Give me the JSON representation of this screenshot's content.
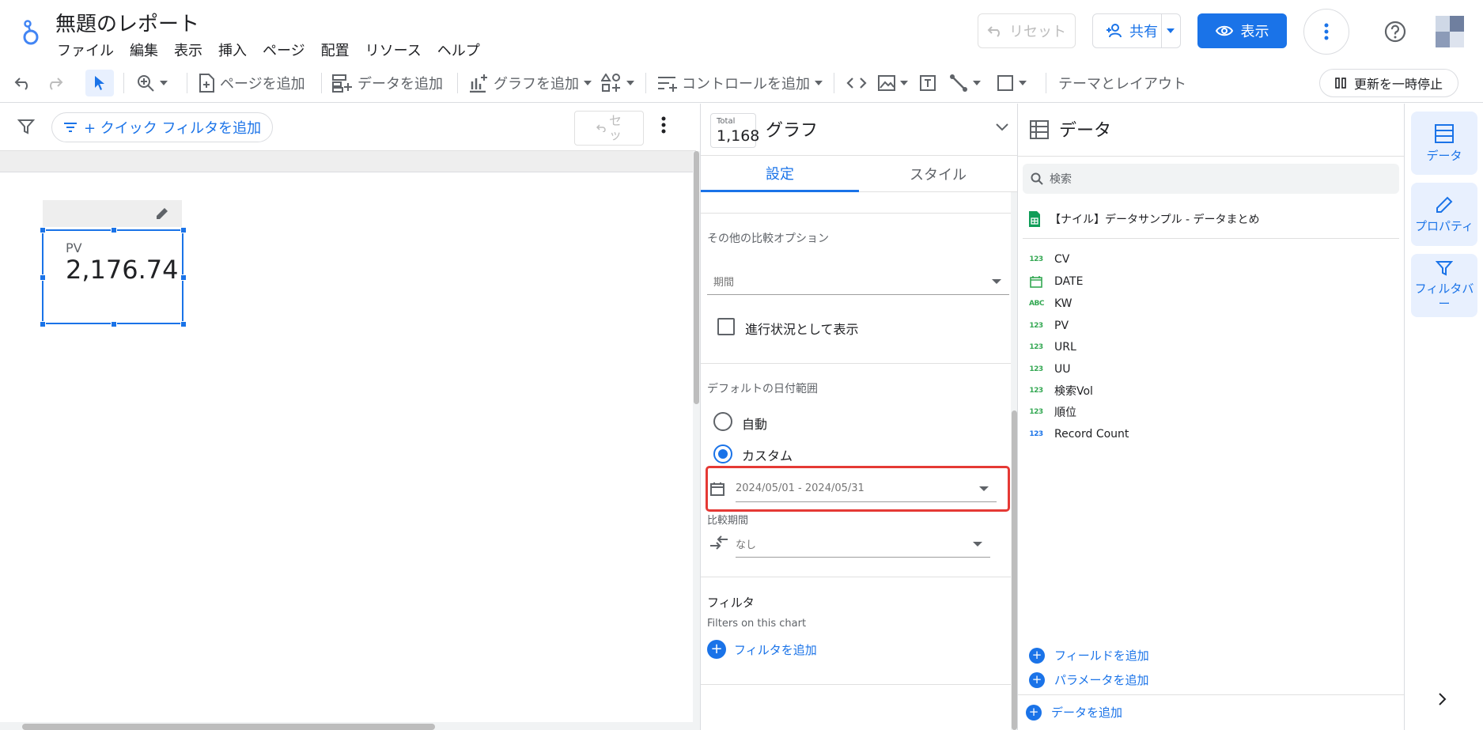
{
  "header": {
    "title": "無題のレポート",
    "menu": [
      "ファイル",
      "編集",
      "表示",
      "挿入",
      "ページ",
      "配置",
      "リソース",
      "ヘルプ"
    ],
    "reset_label": "リセット",
    "share_label": "共有",
    "view_label": "表示"
  },
  "toolbar": {
    "add_page": "ページを追加",
    "add_data": "データを追加",
    "add_chart": "グラフを追加",
    "add_control": "コントロールを追加",
    "theme_layout": "テーマとレイアウト",
    "pause_updates": "更新を一時停止"
  },
  "canvas": {
    "quick_filter": "+ クイック フィルタを追加",
    "reset_small_top": "セ",
    "reset_small_bottom": "ッ",
    "scorecard": {
      "label": "PV",
      "value": "2,176.74"
    }
  },
  "props": {
    "total_label": "Total",
    "total_value": "1,168",
    "title": "グラフ",
    "tabs": [
      "設定",
      "スタイル"
    ],
    "other_compare": "その他の比較オプション",
    "period_placeholder": "期間",
    "show_progress": "進行状況として表示",
    "default_date_range": "デフォルトの日付範囲",
    "auto": "自動",
    "custom": "カスタム",
    "date_range": "2024/05/01 - 2024/05/31",
    "compare_period": "比較期間",
    "compare_none": "なし",
    "filter_title": "フィルタ",
    "filter_sub": "Filters on this chart",
    "add_filter": "フィルタを追加"
  },
  "data": {
    "title": "データ",
    "search_placeholder": "検索",
    "source": "【ナイル】データサンプル - データまとめ",
    "fields": [
      {
        "type": "123",
        "name": "CV"
      },
      {
        "type": "date",
        "name": "DATE"
      },
      {
        "type": "ABC",
        "name": "KW"
      },
      {
        "type": "123",
        "name": "PV"
      },
      {
        "type": "123",
        "name": "URL"
      },
      {
        "type": "123",
        "name": "UU"
      },
      {
        "type": "123",
        "name": "検索Vol"
      },
      {
        "type": "123",
        "name": "順位"
      },
      {
        "type": "123",
        "name": "Record Count"
      }
    ],
    "add_field": "フィールドを追加",
    "add_parameter": "パラメータを追加",
    "add_data": "データを追加"
  },
  "rail": {
    "data": "データ",
    "properties": "プロパティ",
    "filter_bar_top": "フィルタバ",
    "filter_bar_bottom": "ー"
  },
  "colors": {
    "accent": "#1a73e8",
    "highlight": "#e53935",
    "sheets": "#0f9d58"
  }
}
